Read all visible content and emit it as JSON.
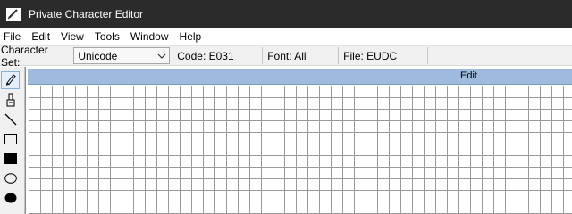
{
  "window": {
    "title": "Private Character Editor",
    "icon": "app-icon"
  },
  "menu": {
    "items": [
      "File",
      "Edit",
      "View",
      "Tools",
      "Window",
      "Help"
    ]
  },
  "toolbar": {
    "charset_label": "Character Set:",
    "charset_value": "Unicode",
    "code": "Code: E031",
    "font": "Font: All",
    "file": "File: EUDC"
  },
  "tools": [
    {
      "name": "pencil-icon",
      "active": true
    },
    {
      "name": "brush-icon",
      "active": false
    },
    {
      "name": "line-icon",
      "active": false
    },
    {
      "name": "hollow-rectangle-icon",
      "active": false
    },
    {
      "name": "filled-rectangle-icon",
      "active": false
    },
    {
      "name": "hollow-ellipse-icon",
      "active": false
    },
    {
      "name": "filled-ellipse-icon",
      "active": false
    }
  ],
  "editor": {
    "header_label": "Edit"
  },
  "colors": {
    "titlebar": "#2b2b2b",
    "edit_header": "#9ebbdd",
    "grid_line": "#9a9a9a"
  }
}
